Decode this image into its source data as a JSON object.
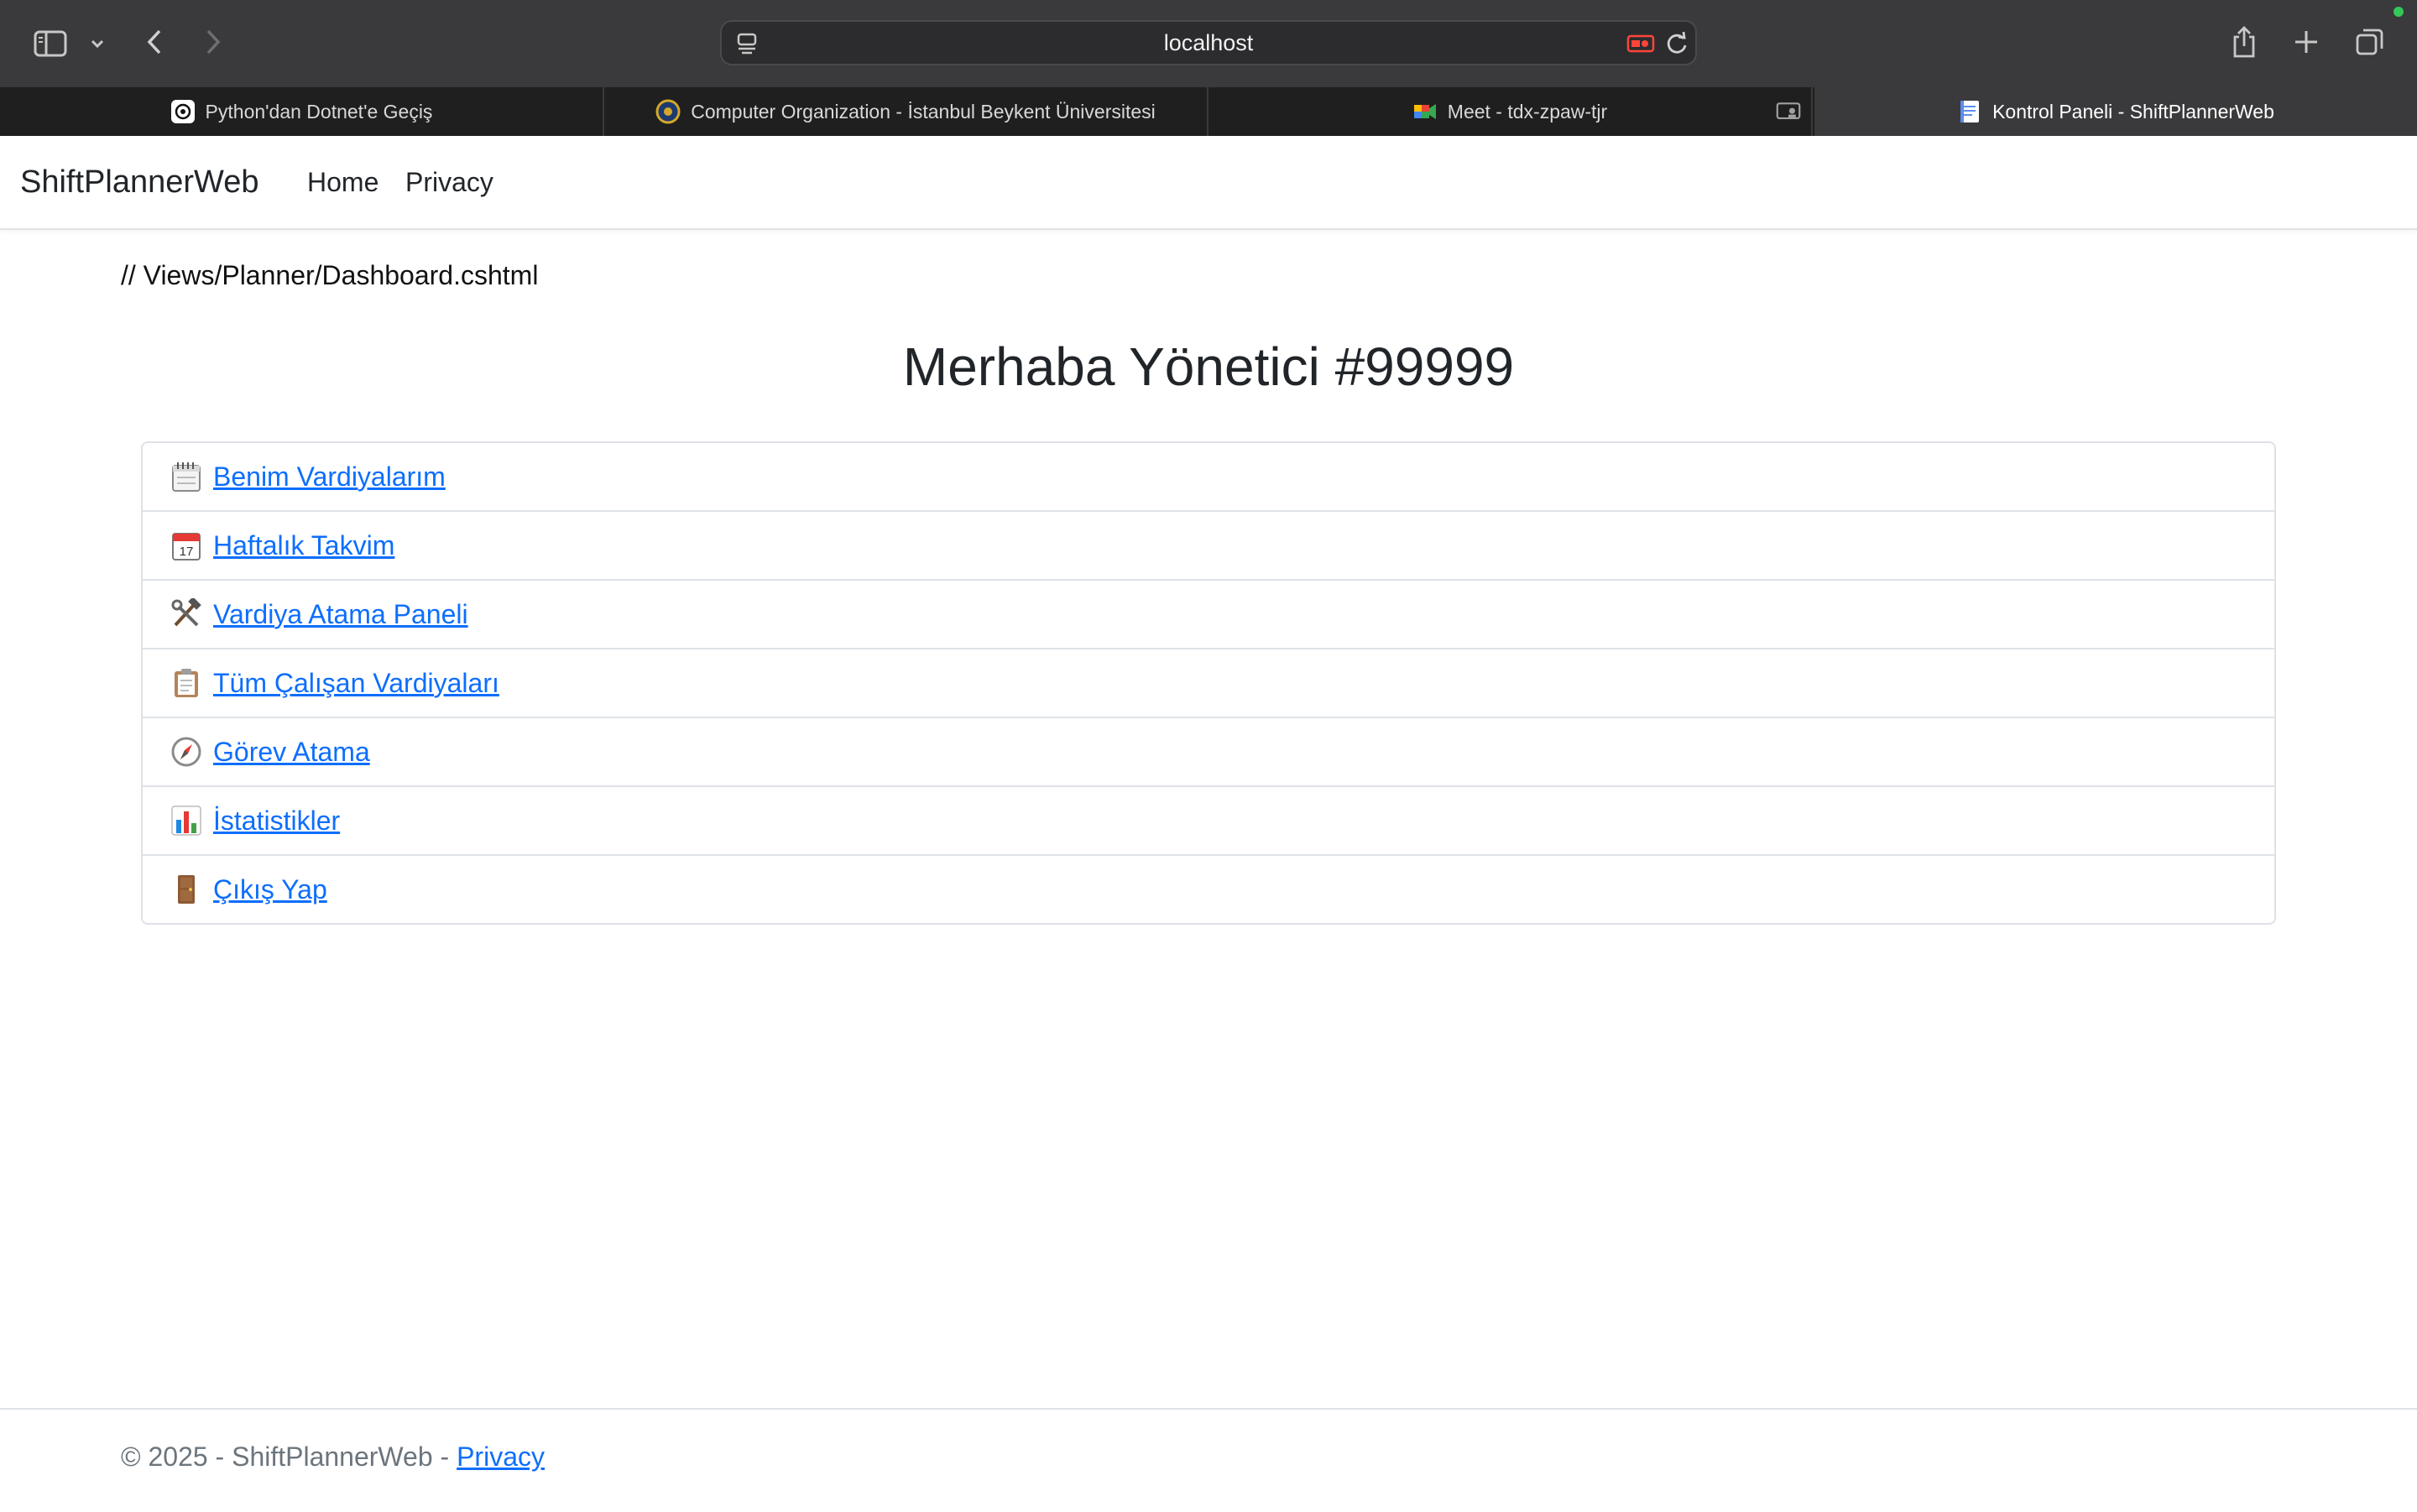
{
  "browser": {
    "url": "localhost",
    "tabs": [
      {
        "title": "Python'dan Dotnet'e Geçiş",
        "favicon": "openai-icon",
        "active": false
      },
      {
        "title": "Computer Organization - İstanbul Beykent Üniversitesi",
        "favicon": "university-seal-icon",
        "active": false
      },
      {
        "title": "Meet - tdx-zpaw-tjr",
        "favicon": "google-meet-icon",
        "active": false
      },
      {
        "title": "",
        "favicon": "screen-share-icon",
        "active": false
      },
      {
        "title": "Kontrol Paneli - ShiftPlannerWeb",
        "favicon": "document-icon",
        "active": true
      }
    ]
  },
  "navbar": {
    "brand": "ShiftPlannerWeb",
    "links": [
      "Home",
      "Privacy"
    ]
  },
  "page": {
    "comment": "// Views/Planner/Dashboard.cshtml",
    "greeting": "Merhaba Yönetici #99999",
    "menu": [
      {
        "label": "Benim Vardiyalarım",
        "icon": "spiral-calendar-icon"
      },
      {
        "label": "Haftalık Takvim",
        "icon": "calendar-icon"
      },
      {
        "label": "Vardiya Atama Paneli",
        "icon": "hammer-wrench-icon"
      },
      {
        "label": "Tüm Çalışan Vardiyaları",
        "icon": "clipboard-icon"
      },
      {
        "label": "Görev Atama",
        "icon": "compass-icon"
      },
      {
        "label": "İstatistikler",
        "icon": "bar-chart-icon"
      },
      {
        "label": "Çıkış Yap",
        "icon": "door-icon"
      }
    ]
  },
  "footer": {
    "text": "© 2025 - ShiftPlannerWeb - ",
    "link": "Privacy"
  },
  "colors": {
    "link": "#0d6efd",
    "toolbar": "#3a3a3c",
    "tabbar": "#1f1f1f"
  }
}
